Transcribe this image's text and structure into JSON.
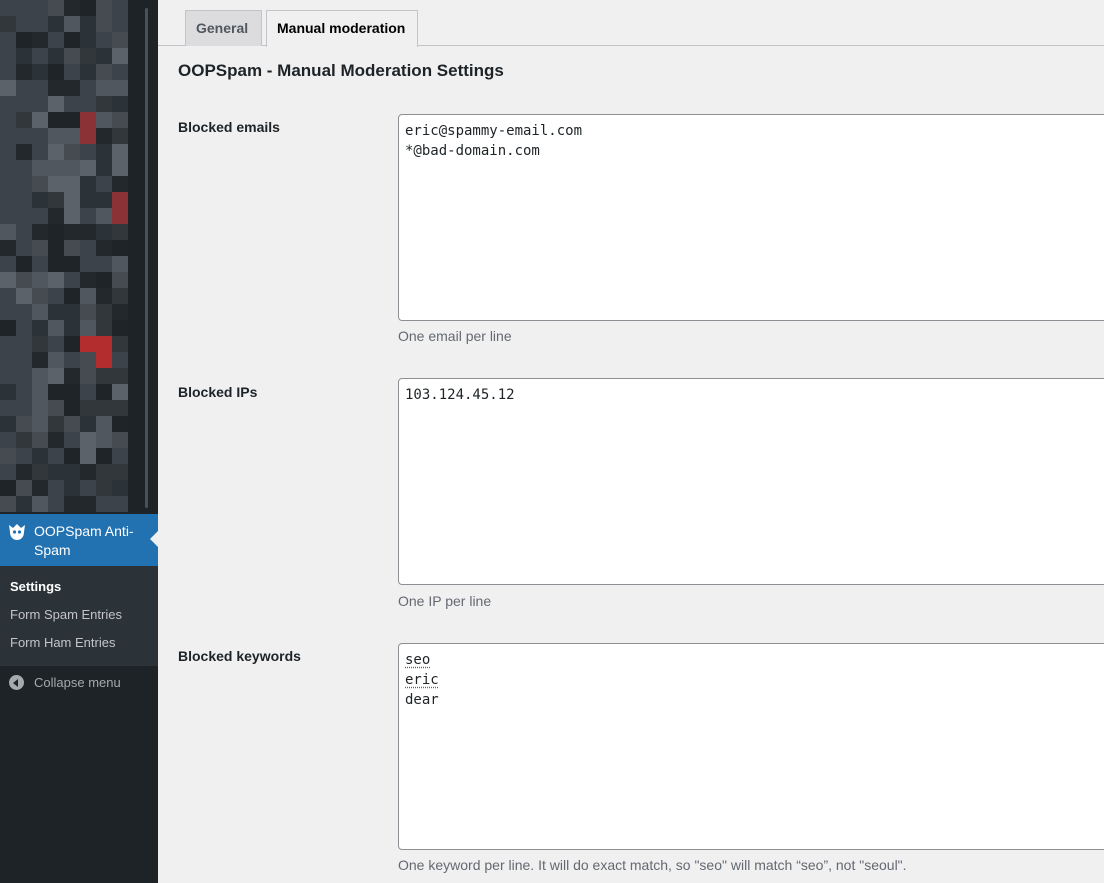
{
  "sidebar": {
    "active_menu_label": "OOPSpam Anti-Spam",
    "active_menu_icon": "oopspam-ghost-icon",
    "submenu": [
      {
        "label": "Settings",
        "current": true
      },
      {
        "label": "Form Spam Entries",
        "current": false
      },
      {
        "label": "Form Ham Entries",
        "current": false
      }
    ],
    "collapse_label": "Collapse menu"
  },
  "tabs": [
    {
      "label": "General",
      "active": false
    },
    {
      "label": "Manual moderation",
      "active": true
    }
  ],
  "page_title": "OOPSpam - Manual Moderation Settings",
  "fields": {
    "emails": {
      "label": "Blocked emails",
      "lines": [
        "eric@spammy-email.com",
        "*@bad-domain.com"
      ],
      "description": "One email per line"
    },
    "ips": {
      "label": "Blocked IPs",
      "lines": [
        "103.124.45.12"
      ],
      "description": "One IP per line"
    },
    "keywords": {
      "label": "Blocked keywords",
      "lines": [
        "seo",
        "eric",
        "dear"
      ],
      "description": "One keyword per line. It will do exact match, so \"seo\" will match “seo”, not \"seoul\"."
    }
  },
  "colors": {
    "sidebar_bg": "#1d2327",
    "submenu_bg": "#2c3338",
    "accent": "#2271b1",
    "page_bg": "#f0f0f1"
  }
}
